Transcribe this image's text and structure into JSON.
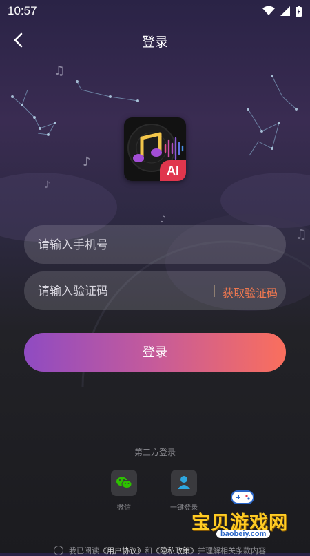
{
  "status_bar": {
    "time": "10:57"
  },
  "header": {
    "title": "登录"
  },
  "form": {
    "phone_placeholder": "请输入手机号",
    "code_placeholder": "请输入验证码",
    "get_code_label": "获取验证码",
    "login_label": "登录"
  },
  "third_party": {
    "label": "第三方登录",
    "options": [
      {
        "label": "微信",
        "icon": "wechat-icon"
      },
      {
        "label": "一键登录",
        "icon": "user-icon"
      }
    ]
  },
  "agreement": {
    "prefix": "我已阅读",
    "user_agreement": "《用户协议》",
    "and": "和",
    "privacy_policy": "《隐私政策》",
    "suffix": "并理解相关条款内容"
  },
  "watermark": {
    "text": "宝贝游戏网",
    "url": "baobeiy.com"
  },
  "colors": {
    "accent": "#f07850",
    "gradient_start": "#8f4bc2",
    "gradient_end": "#fa6f5d",
    "wechat": "#2dc100",
    "user": "#2ea7e0"
  }
}
